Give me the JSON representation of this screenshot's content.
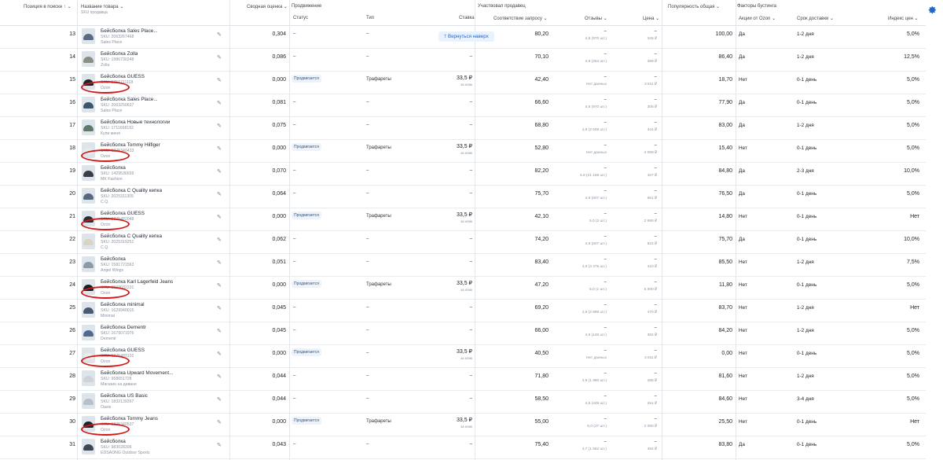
{
  "header": {
    "col_position": "Позиция в поиске",
    "col_name": "Название товара",
    "col_name_sub": "SKU продавца",
    "col_score": "Сводная оценка",
    "group_promotion": "Продвижение",
    "col_status": "Статус",
    "col_type": "Тип",
    "col_bid": "Ставка",
    "group_seller": "Участвовал продавец",
    "col_relevance": "Соответствие запросу",
    "col_reviews": "Отзывы",
    "col_price": "Цена",
    "col_popularity": "Популярность общая",
    "group_boost": "Факторы бустинга",
    "col_actions": "Акции от Ozon",
    "col_delivery": "Срок доставки",
    "col_index": "Индекс цен"
  },
  "back_to_top": "Вернуться наверх",
  "rows": [
    {
      "pos": "13",
      "name": "Бейсболка Sales Place...",
      "sku": "SKU: 2063267468",
      "seller": "Sales Place",
      "score": "0,304",
      "status": "–",
      "type": "–",
      "bid": "–",
      "bid_sub": "",
      "rel": "80,20",
      "rev": "–",
      "rev_sub": "4,8 (970 шт.)",
      "price": "–",
      "price_sub": "345 ₽",
      "pop": "100,00",
      "act": "Да",
      "del": "1-2 дня",
      "idx": "5,0%",
      "promo": false,
      "cap": "#5b6d84"
    },
    {
      "pos": "14",
      "name": "Бейсболка Zolla",
      "sku": "SKU: 1986730248",
      "seller": "Zolla",
      "score": "0,086",
      "status": "–",
      "type": "–",
      "bid": "–",
      "bid_sub": "",
      "rel": "70,10",
      "rev": "–",
      "rev_sub": "4,9 (254 шт.)",
      "price": "–",
      "price_sub": "399 ₽",
      "pop": "86,40",
      "act": "Да",
      "del": "1-2 дня",
      "idx": "12,5%",
      "promo": false,
      "cap": "#8a8f86"
    },
    {
      "pos": "15",
      "name": "Бейсболка GUESS",
      "sku": "SKU: 1351711118",
      "seller": "Ozon",
      "score": "0,000",
      "status": "Продвигается",
      "type": "Трафареты",
      "bid": "33,5 ₽",
      "bid_sub": "за клик",
      "rel": "42,40",
      "rev": "–",
      "rev_sub": "Нет данных",
      "price": "–",
      "price_sub": "3 811 ₽",
      "pop": "18,70",
      "act": "Нет",
      "del": "0-1 день",
      "idx": "5,0%",
      "promo": true,
      "cap": "#1e2228"
    },
    {
      "pos": "16",
      "name": "Бейсболка Sales Place...",
      "sku": "SKU: 2063250637",
      "seller": "Sales Place",
      "score": "0,081",
      "status": "–",
      "type": "–",
      "bid": "–",
      "bid_sub": "",
      "rel": "66,60",
      "rev": "–",
      "rev_sub": "4,8 (970 шт.)",
      "price": "–",
      "price_sub": "305 ₽",
      "pop": "77,90",
      "act": "Да",
      "del": "0-1 день",
      "idx": "5,0%",
      "promo": false,
      "cap": "#3e5570"
    },
    {
      "pos": "17",
      "name": "Бейсболка Новые технологии",
      "sku": "SKU: 1711668192",
      "seller": "Купи меня",
      "score": "0,075",
      "status": "–",
      "type": "–",
      "bid": "–",
      "bid_sub": "",
      "rel": "68,80",
      "rev": "–",
      "rev_sub": "4,8 (2 508 шт.)",
      "price": "–",
      "price_sub": "344 ₽",
      "pop": "83,00",
      "act": "Да",
      "del": "1-2 дня",
      "idx": "5,0%",
      "promo": false,
      "cap": "#5f7a6a"
    },
    {
      "pos": "18",
      "name": "Бейсболка Tommy Hilfiger",
      "sku": "SKU: 1375340433",
      "seller": "Ozon",
      "score": "0,000",
      "status": "Продвигается",
      "type": "Трафареты",
      "bid": "33,5 ₽",
      "bid_sub": "за клик",
      "rel": "52,80",
      "rev": "–",
      "rev_sub": "Нет данных",
      "price": "–",
      "price_sub": "4 099 ₽",
      "pop": "15,40",
      "act": "Нет",
      "del": "0-1 день",
      "idx": "5,0%",
      "promo": true,
      "cap": "#e8eaee"
    },
    {
      "pos": "19",
      "name": "Бейсболка",
      "sku": "SKU: 1429536659",
      "seller": "MK Fashion",
      "score": "0,070",
      "status": "–",
      "type": "–",
      "bid": "–",
      "bid_sub": "",
      "rel": "82,20",
      "rev": "–",
      "rev_sub": "4,8 (21 168 шт.)",
      "price": "–",
      "price_sub": "427 ₽",
      "pop": "84,80",
      "act": "Да",
      "del": "2-3 дня",
      "idx": "10,0%",
      "promo": false,
      "cap": "#3a3f47"
    },
    {
      "pos": "20",
      "name": "Бейсболка C Quality кепка",
      "sku": "SKU: 2025311305",
      "seller": "C.Q.",
      "score": "0,064",
      "status": "–",
      "type": "–",
      "bid": "–",
      "bid_sub": "",
      "rel": "75,70",
      "rev": "–",
      "rev_sub": "4,9 (607 шт.)",
      "price": "–",
      "price_sub": "561 ₽",
      "pop": "76,50",
      "act": "Да",
      "del": "0-1 день",
      "idx": "5,0%",
      "promo": false,
      "cap": "#56697f"
    },
    {
      "pos": "21",
      "name": "Бейсболка GUESS",
      "sku": "SKU: 1375482048",
      "seller": "Ozon",
      "score": "0,000",
      "status": "Продвигается",
      "type": "Трафареты",
      "bid": "33,5 ₽",
      "bid_sub": "за клик",
      "rel": "42,10",
      "rev": "–",
      "rev_sub": "5,0 (2 шт.)",
      "price": "–",
      "price_sub": "2 990 ₽",
      "pop": "14,80",
      "act": "Нет",
      "del": "0-1 день",
      "idx": "Нет",
      "promo": true,
      "cap": "#2a2f36"
    },
    {
      "pos": "22",
      "name": "Бейсболка C Quality кепка",
      "sku": "SKU: 2025319251",
      "seller": "C.Q.",
      "score": "0,062",
      "status": "–",
      "type": "–",
      "bid": "–",
      "bid_sub": "",
      "rel": "74,20",
      "rev": "–",
      "rev_sub": "4,9 (607 шт.)",
      "price": "–",
      "price_sub": "822 ₽",
      "pop": "75,70",
      "act": "Да",
      "del": "0-1 день",
      "idx": "10,0%",
      "promo": false,
      "cap": "#d9d3c4"
    },
    {
      "pos": "23",
      "name": "Бейсболка",
      "sku": "SKU: 1581721563",
      "seller": "Angel Wings",
      "score": "0,051",
      "status": "–",
      "type": "–",
      "bid": "–",
      "bid_sub": "",
      "rel": "83,40",
      "rev": "–",
      "rev_sub": "4,9 (3 476 шт.)",
      "price": "–",
      "price_sub": "410 ₽",
      "pop": "85,50",
      "act": "Нет",
      "del": "1-2 дня",
      "idx": "7,5%",
      "promo": false,
      "cap": "#8f9aa6"
    },
    {
      "pos": "24",
      "name": "Бейсболка Karl Lagerfeld Jeans",
      "sku": "SKU: 1503032231",
      "seller": "Ozon",
      "score": "0,000",
      "status": "Продвигается",
      "type": "Трафареты",
      "bid": "33,5 ₽",
      "bid_sub": "за клик",
      "rel": "47,20",
      "rev": "–",
      "rev_sub": "5,0 (1 шт.)",
      "price": "–",
      "price_sub": "5 000 ₽",
      "pop": "11,80",
      "act": "Нет",
      "del": "0-1 день",
      "idx": "5,0%",
      "promo": true,
      "cap": "#1b1d22"
    },
    {
      "pos": "25",
      "name": "Бейсболка minimal",
      "sku": "SKU: 1629940015",
      "seller": "Minimal",
      "score": "0,045",
      "status": "–",
      "type": "–",
      "bid": "–",
      "bid_sub": "",
      "rel": "69,20",
      "rev": "–",
      "rev_sub": "4,9 (2 898 шт.)",
      "price": "–",
      "price_sub": "470 ₽",
      "pop": "83,70",
      "act": "Нет",
      "del": "1-2 дня",
      "idx": "Нет",
      "promo": false,
      "cap": "#4a5a70"
    },
    {
      "pos": "26",
      "name": "Бейсболка Dementr",
      "sku": "SKU: 1679071976",
      "seller": "Dementr",
      "score": "0,045",
      "status": "–",
      "type": "–",
      "bid": "–",
      "bid_sub": "",
      "rel": "66,00",
      "rev": "–",
      "rev_sub": "4,6 (148 шт.)",
      "price": "–",
      "price_sub": "384 ₽",
      "pop": "84,20",
      "act": "Нет",
      "del": "1-2 дня",
      "idx": "5,0%",
      "promo": false,
      "cap": "#4f6a8e"
    },
    {
      "pos": "27",
      "name": "Бейсболка GUESS",
      "sku": "SKU: 1375483102",
      "seller": "Ozon",
      "score": "0,000",
      "status": "Продвигается",
      "type": "–",
      "bid": "33,5 ₽",
      "bid_sub": "за клик",
      "rel": "40,50",
      "rev": "–",
      "rev_sub": "Нет данных",
      "price": "–",
      "price_sub": "3 611 ₽",
      "pop": "0,00",
      "act": "Нет",
      "del": "0-1 день",
      "idx": "5,0%",
      "promo": true,
      "cap": "#eceef1"
    },
    {
      "pos": "28",
      "name": "Бейсболка Upward Movement...",
      "sku": "SKU: 958651728",
      "seller": "Магазин на диване",
      "score": "0,044",
      "status": "–",
      "type": "–",
      "bid": "–",
      "bid_sub": "",
      "rel": "71,80",
      "rev": "–",
      "rev_sub": "4,9 (1 980 шт.)",
      "price": "–",
      "price_sub": "285 ₽",
      "pop": "81,60",
      "act": "Нет",
      "del": "1-2 дня",
      "idx": "5,0%",
      "promo": false,
      "cap": "#cfd3d8"
    },
    {
      "pos": "29",
      "name": "Бейсболка US Basic",
      "sku": "SKU: 1832139267",
      "seller": "Oasis",
      "score": "0,044",
      "status": "–",
      "type": "–",
      "bid": "–",
      "bid_sub": "",
      "rel": "58,50",
      "rev": "–",
      "rev_sub": "4,6 (449 шт.)",
      "price": "–",
      "price_sub": "251 ₽",
      "pop": "84,60",
      "act": "Нет",
      "del": "3-4 дня",
      "idx": "5,0%",
      "promo": false,
      "cap": "#b8bfc8"
    },
    {
      "pos": "30",
      "name": "Бейсболка Tommy Jeans",
      "sku": "SKU: 1375340537",
      "seller": "Ozon",
      "score": "0,000",
      "status": "Продвигается",
      "type": "Трафареты",
      "bid": "33,5 ₽",
      "bid_sub": "за клик",
      "rel": "55,00",
      "rev": "–",
      "rev_sub": "5,0 (37 шт.)",
      "price": "–",
      "price_sub": "2 390 ₽",
      "pop": "25,50",
      "act": "Нет",
      "del": "0-1 день",
      "idx": "Нет",
      "promo": true,
      "cap": "#20242b"
    },
    {
      "pos": "31",
      "name": "Бейсболка",
      "sku": "SKU: 983028306",
      "seller": "EDSAONG Outdoor Sports",
      "score": "0,043",
      "status": "–",
      "type": "–",
      "bid": "–",
      "bid_sub": "",
      "rel": "75,40",
      "rev": "–",
      "rev_sub": "4,7 (1 562 шт.)",
      "price": "–",
      "price_sub": "494 ₽",
      "pop": "83,80",
      "act": "Да",
      "del": "0-1 день",
      "idx": "5,0%",
      "promo": false,
      "cap": "#3d4758"
    }
  ]
}
